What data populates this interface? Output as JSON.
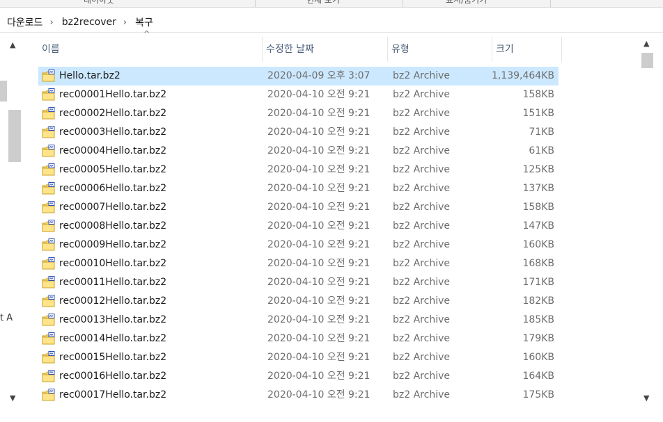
{
  "ribbon": {
    "item1": "레이아웃",
    "item2": "현재 보기",
    "item3": "표시/숨기기"
  },
  "breadcrumb": {
    "items": [
      "다운로드",
      "bz2recover",
      "복구"
    ],
    "separator": "›"
  },
  "nav": {
    "clipped_text": "t A"
  },
  "columns": {
    "name": "이름",
    "date": "수정한 날짜",
    "type": "유형",
    "size": "크기"
  },
  "files": [
    {
      "name": "Hello.tar.bz2",
      "date": "2020-04-09 오후 3:07",
      "type": "bz2 Archive",
      "size": "1,139,464KB"
    },
    {
      "name": "rec00001Hello.tar.bz2",
      "date": "2020-04-10 오전 9:21",
      "type": "bz2 Archive",
      "size": "158KB"
    },
    {
      "name": "rec00002Hello.tar.bz2",
      "date": "2020-04-10 오전 9:21",
      "type": "bz2 Archive",
      "size": "151KB"
    },
    {
      "name": "rec00003Hello.tar.bz2",
      "date": "2020-04-10 오전 9:21",
      "type": "bz2 Archive",
      "size": "71KB"
    },
    {
      "name": "rec00004Hello.tar.bz2",
      "date": "2020-04-10 오전 9:21",
      "type": "bz2 Archive",
      "size": "61KB"
    },
    {
      "name": "rec00005Hello.tar.bz2",
      "date": "2020-04-10 오전 9:21",
      "type": "bz2 Archive",
      "size": "125KB"
    },
    {
      "name": "rec00006Hello.tar.bz2",
      "date": "2020-04-10 오전 9:21",
      "type": "bz2 Archive",
      "size": "137KB"
    },
    {
      "name": "rec00007Hello.tar.bz2",
      "date": "2020-04-10 오전 9:21",
      "type": "bz2 Archive",
      "size": "158KB"
    },
    {
      "name": "rec00008Hello.tar.bz2",
      "date": "2020-04-10 오전 9:21",
      "type": "bz2 Archive",
      "size": "147KB"
    },
    {
      "name": "rec00009Hello.tar.bz2",
      "date": "2020-04-10 오전 9:21",
      "type": "bz2 Archive",
      "size": "160KB"
    },
    {
      "name": "rec00010Hello.tar.bz2",
      "date": "2020-04-10 오전 9:21",
      "type": "bz2 Archive",
      "size": "168KB"
    },
    {
      "name": "rec00011Hello.tar.bz2",
      "date": "2020-04-10 오전 9:21",
      "type": "bz2 Archive",
      "size": "171KB"
    },
    {
      "name": "rec00012Hello.tar.bz2",
      "date": "2020-04-10 오전 9:21",
      "type": "bz2 Archive",
      "size": "182KB"
    },
    {
      "name": "rec00013Hello.tar.bz2",
      "date": "2020-04-10 오전 9:21",
      "type": "bz2 Archive",
      "size": "185KB"
    },
    {
      "name": "rec00014Hello.tar.bz2",
      "date": "2020-04-10 오전 9:21",
      "type": "bz2 Archive",
      "size": "179KB"
    },
    {
      "name": "rec00015Hello.tar.bz2",
      "date": "2020-04-10 오전 9:21",
      "type": "bz2 Archive",
      "size": "160KB"
    },
    {
      "name": "rec00016Hello.tar.bz2",
      "date": "2020-04-10 오전 9:21",
      "type": "bz2 Archive",
      "size": "164KB"
    },
    {
      "name": "rec00017Hello.tar.bz2",
      "date": "2020-04-10 오전 9:21",
      "type": "bz2 Archive",
      "size": "175KB"
    }
  ],
  "selected_index": 0,
  "icons": {
    "file": "bz2-file-icon",
    "sort": "sort-ascending-icon",
    "up": "scroll-up-icon",
    "down": "scroll-down-icon"
  },
  "colors": {
    "selection": "#cce8ff",
    "header_text": "#4c607a",
    "secondary_text": "#6d6d6d"
  }
}
